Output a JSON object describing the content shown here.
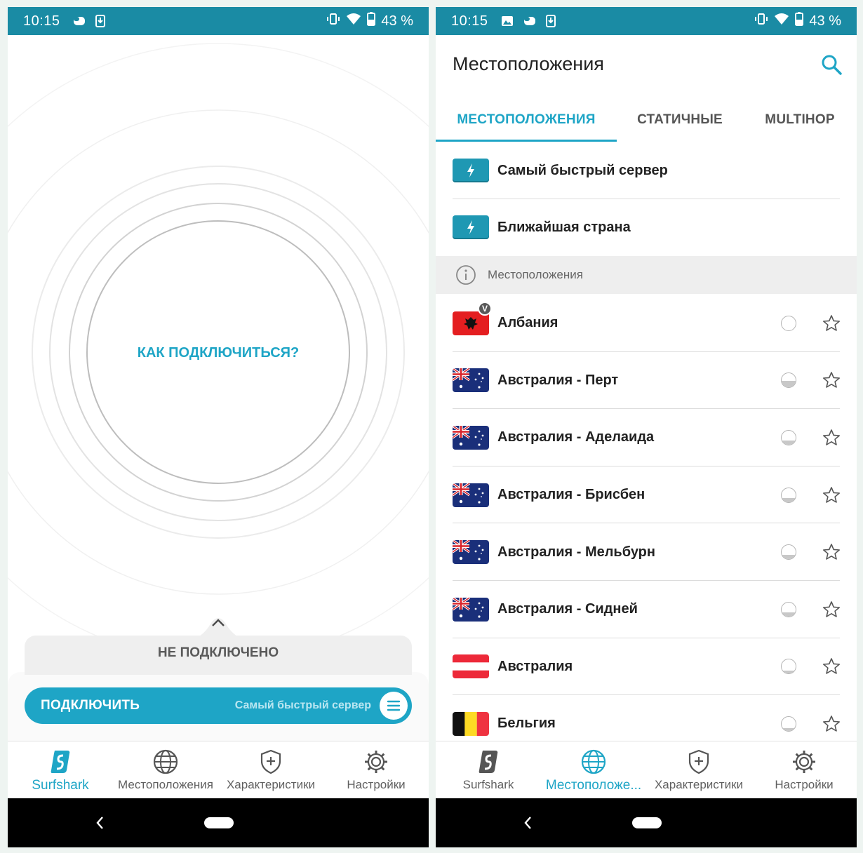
{
  "statusbar": {
    "time": "10:15",
    "battery": "43 %"
  },
  "home": {
    "how_to_connect": "КАК ПОДКЛЮЧИТЬСЯ?",
    "status": "НЕ ПОДКЛЮЧЕНО",
    "connect_label": "ПОДКЛЮЧИТЬ",
    "connect_target": "Самый быстрый сервер"
  },
  "nav_left": {
    "items": [
      {
        "label": "Surfshark",
        "icon": "surfshark-logo-icon",
        "active": true
      },
      {
        "label": "Местоположения",
        "icon": "globe-icon",
        "active": false
      },
      {
        "label": "Характеристики",
        "icon": "shield-plus-icon",
        "active": false
      },
      {
        "label": "Настройки",
        "icon": "gear-icon",
        "active": false
      }
    ]
  },
  "nav_right": {
    "items": [
      {
        "label": "Surfshark",
        "icon": "surfshark-logo-icon",
        "active": false
      },
      {
        "label": "Местоположе...",
        "icon": "globe-icon",
        "active": true
      },
      {
        "label": "Характеристики",
        "icon": "shield-plus-icon",
        "active": false
      },
      {
        "label": "Настройки",
        "icon": "gear-icon",
        "active": false
      }
    ]
  },
  "locations": {
    "title": "Местоположения",
    "tabs": [
      {
        "label": "МЕСТОПОЛОЖЕНИЯ",
        "active": true
      },
      {
        "label": "СТАТИЧНЫЕ",
        "active": false
      },
      {
        "label": "MULTIHOP",
        "active": false
      }
    ],
    "quick": [
      {
        "label": "Самый быстрый сервер",
        "icon": "bolt-icon"
      },
      {
        "label": "Ближайшая страна",
        "icon": "bolt-icon"
      }
    ],
    "section_label": "Местоположения",
    "items": [
      {
        "name": "Албания",
        "flag": "albania",
        "load": 0.0,
        "badge": "V"
      },
      {
        "name": "Австралия - Перт",
        "flag": "australia",
        "load": 0.45
      },
      {
        "name": "Австралия - Аделаида",
        "flag": "australia",
        "load": 0.3
      },
      {
        "name": "Австралия - Брисбен",
        "flag": "australia",
        "load": 0.3
      },
      {
        "name": "Австралия - Мельбурн",
        "flag": "australia",
        "load": 0.3
      },
      {
        "name": "Австралия - Сидней",
        "flag": "australia",
        "load": 0.3
      },
      {
        "name": "Австралия",
        "flag": "austria",
        "load": 0.2
      },
      {
        "name": "Бельгия",
        "flag": "belgium",
        "load": 0.2
      }
    ]
  },
  "colors": {
    "accent": "#1ea5c6",
    "statusbar": "#1a8ba4",
    "bolt_box": "#1f98b3"
  }
}
